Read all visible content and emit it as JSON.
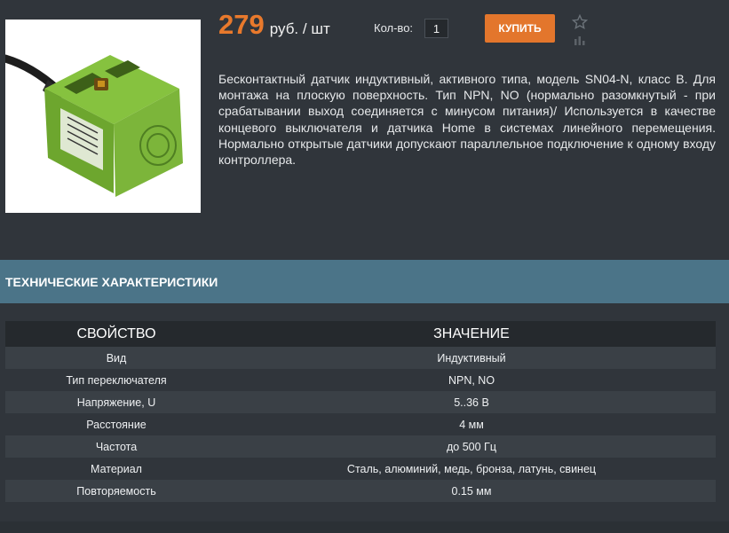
{
  "product": {
    "price_value": "279",
    "price_unit": "руб. / шт",
    "quantity_label": "Кол-во:",
    "quantity_value": "1",
    "buy_label": "КУПИТЬ",
    "image_alt": "SN04-N",
    "description": "Бесконтактный датчик индуктивный, активного типа, модель SN04-N, класс B. Для монтажа на плоскую поверхность. Тип NPN, NO (нормально разомкнутый - при срабатывании выход соединяется с минусом питания)/ Используется в качестве концевого выключателя и датчика Home в системах линейного перемещения. Нормально открытые датчики допускают параллельное подключение к одному входу контроллера.",
    "icons": {
      "favorite": "star-icon",
      "compare": "compare-icon"
    }
  },
  "specs": {
    "title": "ТЕХНИЧЕСКИЕ ХАРАКТЕРИСТИКИ",
    "columns": [
      "СВОЙСТВО",
      "ЗНАЧЕНИЕ"
    ],
    "rows": [
      {
        "property": "Вид",
        "value": "Индуктивный"
      },
      {
        "property": "Тип переключателя",
        "value": "NPN, NO"
      },
      {
        "property": "Напряжение, U",
        "value": "5..36 В"
      },
      {
        "property": "Расстояние",
        "value": "4 мм"
      },
      {
        "property": "Частота",
        "value": "до 500 Гц"
      },
      {
        "property": "Материал",
        "value": "Сталь, алюминий, медь, бронза, латунь, свинец"
      },
      {
        "property": "Повторяемость",
        "value": "0.15 мм"
      }
    ]
  },
  "colors": {
    "accent": "#e3762c",
    "price": "#e8792c",
    "header_band": "#4b7488",
    "background": "#30353b"
  }
}
